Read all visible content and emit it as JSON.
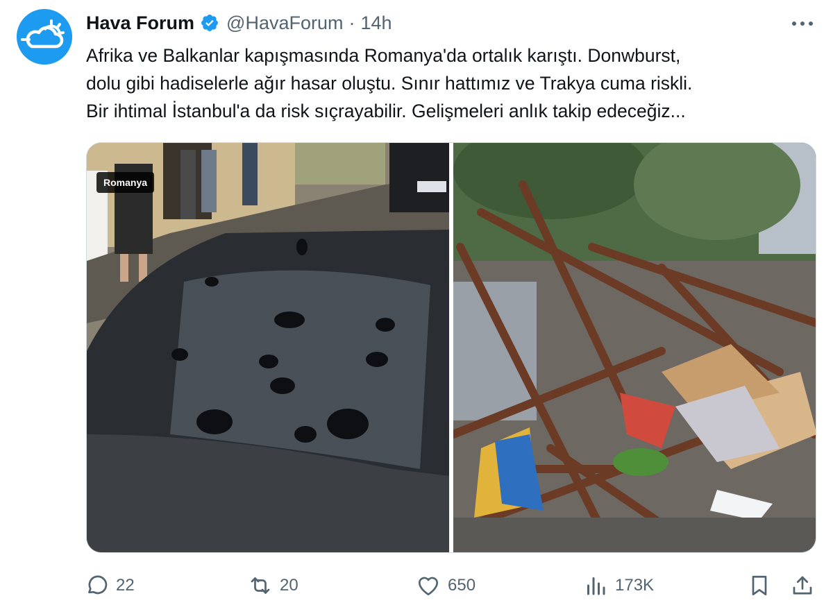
{
  "author": {
    "display_name": "Hava Forum",
    "handle": "@HavaForum",
    "separator": "·",
    "timestamp": "14h",
    "verified": true
  },
  "tweet": {
    "text_lines": [
      "Afrika ve Balkanlar kapışmasında Romanya'da ortalık karıştı. Donwburst,",
      "dolu gibi hadiselerle ağır hasar oluştu. Sınır hattımız ve Trakya cuma riskli.",
      "Bir ihtimal İstanbul'a da risk sıçrayabilir. Gelişmeleri anlık takip edeceğiz..."
    ]
  },
  "media": {
    "left_photo_tag": "Romanya"
  },
  "stats": {
    "replies": "22",
    "retweets": "20",
    "likes": "650",
    "views": "173K"
  },
  "icons": {
    "avatar": "weather-cloud-sun-icon",
    "verified": "verified-badge-icon",
    "more": "more-dots-icon",
    "reply": "reply-icon",
    "retweet": "retweet-icon",
    "like": "heart-icon",
    "views": "views-chart-icon",
    "bookmark": "bookmark-icon",
    "share": "share-icon"
  },
  "colors": {
    "verified_badge": "#1d9bf0",
    "avatar_bg": "#1d9bf0",
    "text_primary": "#0f1419",
    "text_secondary": "#536471"
  }
}
